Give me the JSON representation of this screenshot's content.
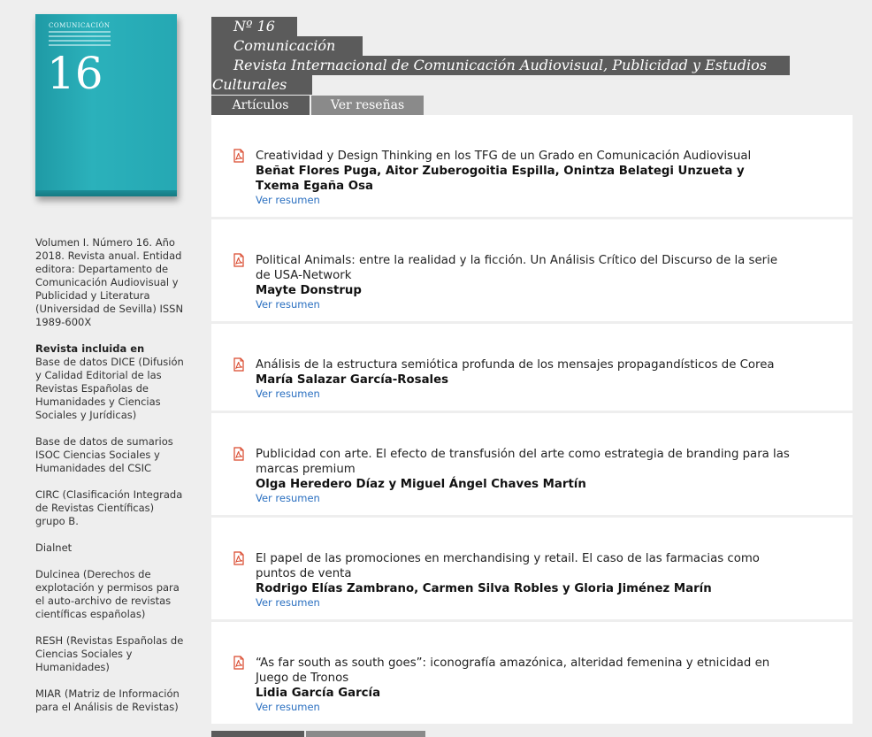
{
  "cover": {
    "brand": "COMUNICACIÓN",
    "number": "16"
  },
  "side": {
    "volume_info": "Volumen I. Número 16. Año 2018. Revista anual. Entidad editora: Departamento de Comunicación Audiovisual y Publicidad y Literatura (Universidad de Sevilla) ISSN 1989-600X",
    "included_heading": "Revista incluida en",
    "databases": [
      "Base de datos DICE (Difusión y Calidad Editorial de las Revistas Españolas de Humanidades y Ciencias Sociales y Jurídicas)",
      "Base de datos de sumarios ISOC Ciencias Sociales y Humanidades del CSIC",
      "CIRC (Clasificación Integrada de Revistas Científicas) grupo B.",
      "Dialnet",
      "Dulcinea (Derechos de explotación y permisos para el auto-archivo de revistas científicas españolas)",
      "RESH (Revistas Españolas de Ciencias Sociales y Humanidades)",
      "MIAR (Matriz de Información para el Análisis de Revistas)"
    ]
  },
  "header": {
    "issue": "Nº 16",
    "journal": "Comunicación",
    "subtitle_line1": "Revista Internacional de Comunicación Audiovisual, Publicidad y Estudios",
    "subtitle_line2": "Culturales"
  },
  "tabs": [
    {
      "label": "Artículos",
      "active": true
    },
    {
      "label": "Ver reseñas",
      "active": false
    }
  ],
  "articles": [
    {
      "title": "Creatividad y Design Thinking en los TFG de un Grado en Comunicación Audiovisual",
      "authors": "Beñat Flores Puga, Aitor Zuberogoitia Espilla, Onintza Belategi Unzueta y Txema Egaña Osa",
      "link": "Ver resumen"
    },
    {
      "title": "Political Animals: entre la realidad y la ficción. Un Análisis Crítico del Discurso de la serie de USA-Network",
      "authors": "Mayte Donstrup",
      "link": "Ver resumen"
    },
    {
      "title": "Análisis de la estructura semiótica profunda de los mensajes propagandísticos de Corea",
      "authors": "María Salazar García-Rosales",
      "link": "Ver resumen"
    },
    {
      "title": "Publicidad con arte. El efecto de transfusión del arte como estrategia de branding para las marcas premium",
      "authors": "Olga Heredero Díaz y Miguel Ángel Chaves Martín",
      "link": "Ver resumen"
    },
    {
      "title": "El papel de las promociones en merchandising y retail. El caso de las farmacias como puntos de venta",
      "authors": "Rodrigo Elías Zambrano, Carmen Silva Robles y Gloria Jiménez Marín",
      "link": "Ver resumen"
    },
    {
      "title": "“As far south as south goes”: iconografía amazónica, alteridad femenina y etnicidad en Juego de Tronos",
      "authors": "Lidia García García",
      "link": "Ver resumen"
    }
  ],
  "colors": {
    "background": "#eeeeee",
    "header_bar": "#5b5b5b",
    "tab_inactive": "#8a8a8a",
    "link": "#2a6fc0",
    "cover": "#2bb1bb",
    "pdf_icon": "#d9472b"
  },
  "icons": {
    "article": "pdf-icon"
  }
}
